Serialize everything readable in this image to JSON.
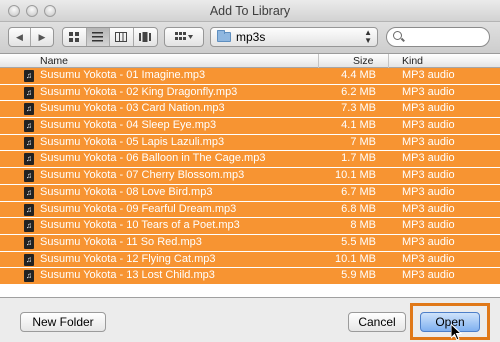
{
  "window": {
    "title": "Add To Library"
  },
  "toolbar": {
    "back_icon": "chevron-left-icon",
    "forward_icon": "chevron-right-icon",
    "view_icons": [
      "icon-view-icon",
      "list-view-icon",
      "column-view-icon",
      "coverflow-view-icon"
    ],
    "arrange_icon": "arrange-icon",
    "path": "mp3s",
    "search": {
      "value": "",
      "placeholder": ""
    }
  },
  "list": {
    "columns": {
      "name": "Name",
      "size": "Size",
      "kind": "Kind"
    },
    "files": [
      {
        "name": "Susumu Yokota - 01 Imagine.mp3",
        "size": "4.4 MB",
        "kind": "MP3 audio"
      },
      {
        "name": "Susumu Yokota - 02 King Dragonfly.mp3",
        "size": "6.2 MB",
        "kind": "MP3 audio"
      },
      {
        "name": "Susumu Yokota - 03 Card Nation.mp3",
        "size": "7.3 MB",
        "kind": "MP3 audio"
      },
      {
        "name": "Susumu Yokota - 04 Sleep Eye.mp3",
        "size": "4.1 MB",
        "kind": "MP3 audio"
      },
      {
        "name": "Susumu Yokota - 05 Lapis Lazuli.mp3",
        "size": "7 MB",
        "kind": "MP3 audio"
      },
      {
        "name": "Susumu Yokota - 06 Balloon in The Cage.mp3",
        "size": "1.7 MB",
        "kind": "MP3 audio"
      },
      {
        "name": "Susumu Yokota - 07 Cherry Blossom.mp3",
        "size": "10.1 MB",
        "kind": "MP3 audio"
      },
      {
        "name": "Susumu Yokota - 08 Love Bird.mp3",
        "size": "6.7 MB",
        "kind": "MP3 audio"
      },
      {
        "name": "Susumu Yokota - 09 Fearful Dream.mp3",
        "size": "6.8 MB",
        "kind": "MP3 audio"
      },
      {
        "name": "Susumu Yokota - 10 Tears of a Poet.mp3",
        "size": "8 MB",
        "kind": "MP3 audio"
      },
      {
        "name": "Susumu Yokota - 11 So Red.mp3",
        "size": "5.5 MB",
        "kind": "MP3 audio"
      },
      {
        "name": "Susumu Yokota - 12 Flying Cat.mp3",
        "size": "10.1 MB",
        "kind": "MP3 audio"
      },
      {
        "name": "Susumu Yokota - 13 Lost Child.mp3",
        "size": "5.9 MB",
        "kind": "MP3 audio"
      }
    ]
  },
  "buttons": {
    "new_folder": "New Folder",
    "cancel": "Cancel",
    "open": "Open"
  },
  "colors": {
    "selection": "#f79432",
    "highlight_box": "#e07818"
  }
}
